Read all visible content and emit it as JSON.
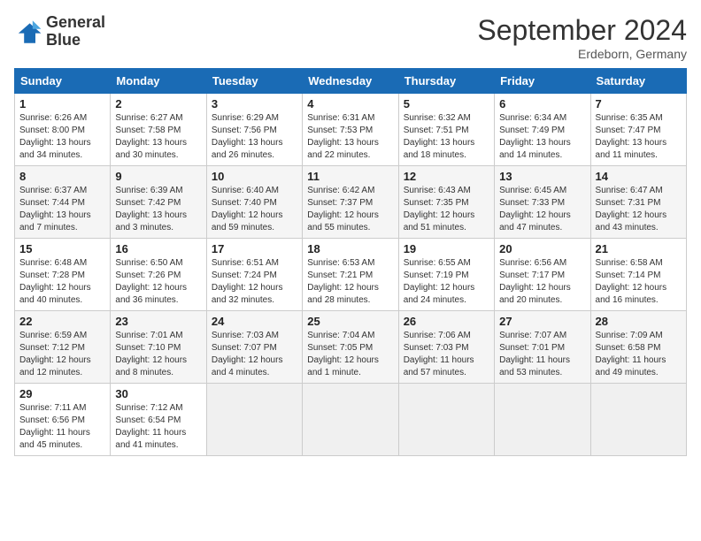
{
  "header": {
    "logo_line1": "General",
    "logo_line2": "Blue",
    "month_title": "September 2024",
    "subtitle": "Erdeborn, Germany"
  },
  "columns": [
    "Sunday",
    "Monday",
    "Tuesday",
    "Wednesday",
    "Thursday",
    "Friday",
    "Saturday"
  ],
  "weeks": [
    [
      {
        "day": "1",
        "info": "Sunrise: 6:26 AM\nSunset: 8:00 PM\nDaylight: 13 hours\nand 34 minutes."
      },
      {
        "day": "2",
        "info": "Sunrise: 6:27 AM\nSunset: 7:58 PM\nDaylight: 13 hours\nand 30 minutes."
      },
      {
        "day": "3",
        "info": "Sunrise: 6:29 AM\nSunset: 7:56 PM\nDaylight: 13 hours\nand 26 minutes."
      },
      {
        "day": "4",
        "info": "Sunrise: 6:31 AM\nSunset: 7:53 PM\nDaylight: 13 hours\nand 22 minutes."
      },
      {
        "day": "5",
        "info": "Sunrise: 6:32 AM\nSunset: 7:51 PM\nDaylight: 13 hours\nand 18 minutes."
      },
      {
        "day": "6",
        "info": "Sunrise: 6:34 AM\nSunset: 7:49 PM\nDaylight: 13 hours\nand 14 minutes."
      },
      {
        "day": "7",
        "info": "Sunrise: 6:35 AM\nSunset: 7:47 PM\nDaylight: 13 hours\nand 11 minutes."
      }
    ],
    [
      {
        "day": "8",
        "info": "Sunrise: 6:37 AM\nSunset: 7:44 PM\nDaylight: 13 hours\nand 7 minutes."
      },
      {
        "day": "9",
        "info": "Sunrise: 6:39 AM\nSunset: 7:42 PM\nDaylight: 13 hours\nand 3 minutes."
      },
      {
        "day": "10",
        "info": "Sunrise: 6:40 AM\nSunset: 7:40 PM\nDaylight: 12 hours\nand 59 minutes."
      },
      {
        "day": "11",
        "info": "Sunrise: 6:42 AM\nSunset: 7:37 PM\nDaylight: 12 hours\nand 55 minutes."
      },
      {
        "day": "12",
        "info": "Sunrise: 6:43 AM\nSunset: 7:35 PM\nDaylight: 12 hours\nand 51 minutes."
      },
      {
        "day": "13",
        "info": "Sunrise: 6:45 AM\nSunset: 7:33 PM\nDaylight: 12 hours\nand 47 minutes."
      },
      {
        "day": "14",
        "info": "Sunrise: 6:47 AM\nSunset: 7:31 PM\nDaylight: 12 hours\nand 43 minutes."
      }
    ],
    [
      {
        "day": "15",
        "info": "Sunrise: 6:48 AM\nSunset: 7:28 PM\nDaylight: 12 hours\nand 40 minutes."
      },
      {
        "day": "16",
        "info": "Sunrise: 6:50 AM\nSunset: 7:26 PM\nDaylight: 12 hours\nand 36 minutes."
      },
      {
        "day": "17",
        "info": "Sunrise: 6:51 AM\nSunset: 7:24 PM\nDaylight: 12 hours\nand 32 minutes."
      },
      {
        "day": "18",
        "info": "Sunrise: 6:53 AM\nSunset: 7:21 PM\nDaylight: 12 hours\nand 28 minutes."
      },
      {
        "day": "19",
        "info": "Sunrise: 6:55 AM\nSunset: 7:19 PM\nDaylight: 12 hours\nand 24 minutes."
      },
      {
        "day": "20",
        "info": "Sunrise: 6:56 AM\nSunset: 7:17 PM\nDaylight: 12 hours\nand 20 minutes."
      },
      {
        "day": "21",
        "info": "Sunrise: 6:58 AM\nSunset: 7:14 PM\nDaylight: 12 hours\nand 16 minutes."
      }
    ],
    [
      {
        "day": "22",
        "info": "Sunrise: 6:59 AM\nSunset: 7:12 PM\nDaylight: 12 hours\nand 12 minutes."
      },
      {
        "day": "23",
        "info": "Sunrise: 7:01 AM\nSunset: 7:10 PM\nDaylight: 12 hours\nand 8 minutes."
      },
      {
        "day": "24",
        "info": "Sunrise: 7:03 AM\nSunset: 7:07 PM\nDaylight: 12 hours\nand 4 minutes."
      },
      {
        "day": "25",
        "info": "Sunrise: 7:04 AM\nSunset: 7:05 PM\nDaylight: 12 hours\nand 1 minute."
      },
      {
        "day": "26",
        "info": "Sunrise: 7:06 AM\nSunset: 7:03 PM\nDaylight: 11 hours\nand 57 minutes."
      },
      {
        "day": "27",
        "info": "Sunrise: 7:07 AM\nSunset: 7:01 PM\nDaylight: 11 hours\nand 53 minutes."
      },
      {
        "day": "28",
        "info": "Sunrise: 7:09 AM\nSunset: 6:58 PM\nDaylight: 11 hours\nand 49 minutes."
      }
    ],
    [
      {
        "day": "29",
        "info": "Sunrise: 7:11 AM\nSunset: 6:56 PM\nDaylight: 11 hours\nand 45 minutes."
      },
      {
        "day": "30",
        "info": "Sunrise: 7:12 AM\nSunset: 6:54 PM\nDaylight: 11 hours\nand 41 minutes."
      },
      {
        "day": "",
        "info": ""
      },
      {
        "day": "",
        "info": ""
      },
      {
        "day": "",
        "info": ""
      },
      {
        "day": "",
        "info": ""
      },
      {
        "day": "",
        "info": ""
      }
    ]
  ]
}
